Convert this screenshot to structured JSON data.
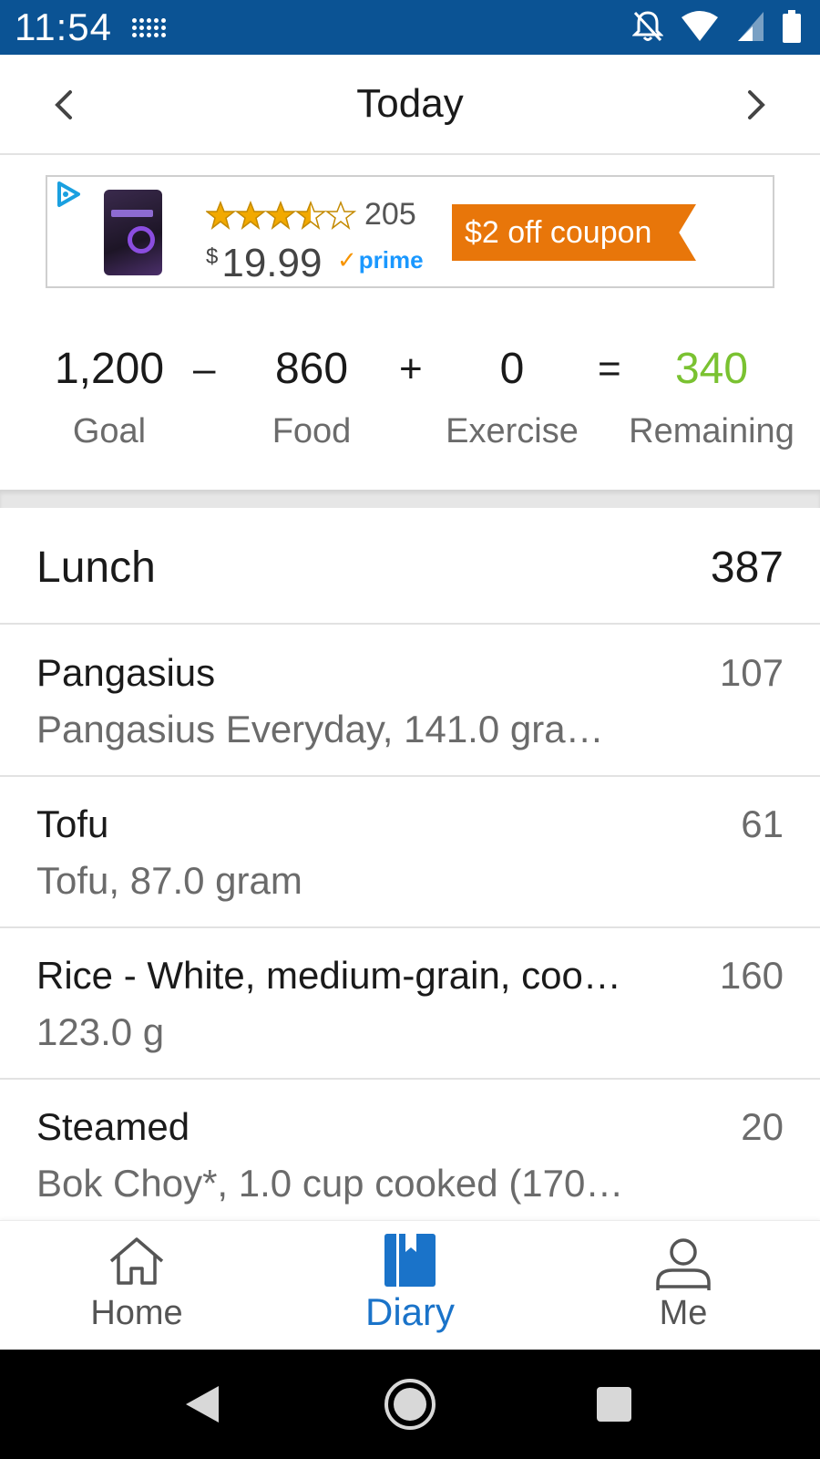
{
  "status_bar": {
    "time": "11:54",
    "icons": [
      "grid-dots-icon",
      "notifications-off-icon",
      "wifi-icon",
      "cell-signal-icon",
      "battery-icon"
    ]
  },
  "header": {
    "title": "Today",
    "prev_icon": "chevron-left-icon",
    "next_icon": "chevron-right-icon"
  },
  "ad": {
    "reviews": "205",
    "rating": 3.5,
    "price_currency": "$",
    "price_value": "19.99",
    "prime_label": "prime",
    "coupon_label": "$2 off coupon",
    "coupon_color": "#e8760a"
  },
  "summary": {
    "goal_value": "1,200",
    "goal_label": "Goal",
    "op_minus": "–",
    "food_value": "860",
    "food_label": "Food",
    "op_plus": "+",
    "exercise_value": "0",
    "exercise_label": "Exercise",
    "op_equals": "=",
    "remaining_value": "340",
    "remaining_label": "Remaining",
    "remaining_color": "#7ac231"
  },
  "meal": {
    "title": "Lunch",
    "total": "387",
    "items": [
      {
        "name": "Pangasius",
        "detail": "Pangasius Everyday, 141.0 gra…",
        "calories": "107"
      },
      {
        "name": "Tofu",
        "detail": "Tofu, 87.0 gram",
        "calories": "61"
      },
      {
        "name": "Rice - White, medium-grain, coo…",
        "detail": "123.0 g",
        "calories": "160"
      },
      {
        "name": "Steamed",
        "detail": "Bok Choy*, 1.0 cup cooked (170…",
        "calories": "20"
      }
    ]
  },
  "bottom_nav": {
    "tabs": [
      {
        "label": "Home",
        "icon": "home-icon"
      },
      {
        "label": "Diary",
        "icon": "diary-book-icon"
      },
      {
        "label": "Me",
        "icon": "person-icon"
      }
    ],
    "active_color": "#1a73c9"
  },
  "system_nav": {
    "icons": [
      "back-triangle-icon",
      "home-circle-icon",
      "recents-square-icon"
    ]
  }
}
